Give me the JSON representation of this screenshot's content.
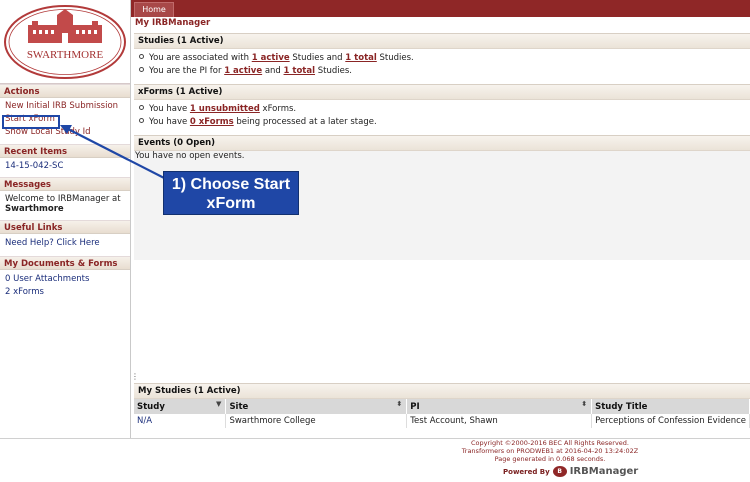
{
  "logo": {
    "text": "SWARTHMORE"
  },
  "topbar": {
    "home_label": "Home"
  },
  "main": {
    "title": "My IRBManager"
  },
  "sidebar": {
    "actions": {
      "header": "Actions",
      "items": [
        "New Initial IRB Submission",
        "Start xForm",
        "Show Local Study Id"
      ]
    },
    "recent": {
      "header": "Recent Items",
      "items": [
        "14-15-042-SC"
      ]
    },
    "messages": {
      "header": "Messages",
      "text_prefix": "Welcome to IRBManager at ",
      "text_bold": "Swarthmore"
    },
    "useful_links": {
      "header": "Useful Links",
      "items": [
        "Need Help? Click Here"
      ]
    },
    "my_docs": {
      "header": "My Documents & Forms",
      "items": [
        "0 User Attachments",
        "2 xForms"
      ]
    }
  },
  "studies_panel": {
    "header": "Studies (1 Active)",
    "row1": {
      "pre": "You are associated with ",
      "link1": "1 active",
      "mid": " Studies and ",
      "link2": "1 total",
      "post": " Studies."
    },
    "row2": {
      "pre": "You are the PI for ",
      "link1": "1 active",
      "mid": " and ",
      "link2": "1 total",
      "post": " Studies."
    }
  },
  "xforms_panel": {
    "header": "xForms (1 Active)",
    "row1": {
      "pre": "You have ",
      "link": "1 unsubmitted",
      "post": " xForms."
    },
    "row2": {
      "pre": "You have ",
      "link": "0 xForms",
      "post": " being processed at a later stage."
    }
  },
  "events_panel": {
    "header": "Events (0 Open)",
    "text": "You have no open events."
  },
  "my_studies": {
    "header": "My Studies (1 Active)",
    "columns": [
      "Study",
      "Site",
      "PI",
      "Study Title"
    ],
    "rows": [
      [
        "N/A",
        "Swarthmore College",
        "Test Account, Shawn",
        "Perceptions of Confession Evidence"
      ]
    ]
  },
  "footer": {
    "copyright": "Copyright ©2000-2016 BEC All Rights Reserved.",
    "transformers": "Transformers on PRODWEB1 at 2016-04-20 13:24:02Z",
    "generated": "Page generated in 0.068 seconds.",
    "powered_by": "Powered By",
    "brand": "IRBManager"
  },
  "callout": {
    "line1": "1) Choose Start",
    "line2": "xForm"
  },
  "colors": {
    "maroon": "#8f2727",
    "callout_blue": "#1f47a6",
    "link_blue": "#1a2d7a"
  }
}
